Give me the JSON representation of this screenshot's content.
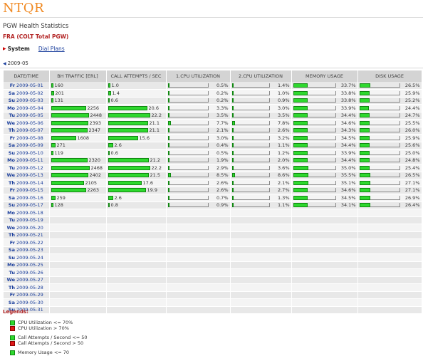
{
  "app": {
    "logo": "NTQR",
    "subtitle": "PGW Health Statistics",
    "node": "FRA (COLT Total PGW)"
  },
  "nav": {
    "system_label": "System",
    "dial_plans_label": "Dial Plans"
  },
  "month": "2009-05",
  "columns": [
    "DATE/TIME",
    "BH TRAFFIC [ERL]",
    "CALL ATTEMPTS / SEC",
    "1.CPU UTILIZATION",
    "2.CPU UTILIZATION",
    "MEMORY USAGE",
    "DISK USAGE"
  ],
  "scale": {
    "traffic_max": 2480,
    "calls_max": 22.5
  },
  "rows": [
    {
      "dow": "Fr",
      "date": "2009-05-01",
      "traffic": "160",
      "calls": "1.0",
      "cpu1": "0.5%",
      "cpu2": "1.4%",
      "mem": "33.7%",
      "disk": "26.5%"
    },
    {
      "dow": "Sa",
      "date": "2009-05-02",
      "traffic": "201",
      "calls": "1.4",
      "cpu1": "0.2%",
      "cpu2": "1.0%",
      "mem": "33.8%",
      "disk": "25.9%"
    },
    {
      "dow": "Su",
      "date": "2009-05-03",
      "traffic": "131",
      "calls": "0.6",
      "cpu1": "0.2%",
      "cpu2": "0.9%",
      "mem": "33.8%",
      "disk": "25.2%"
    },
    {
      "dow": "Mo",
      "date": "2009-05-04",
      "traffic": "2256",
      "calls": "20.6",
      "cpu1": "3.3%",
      "cpu2": "3.0%",
      "mem": "33.9%",
      "disk": "24.4%"
    },
    {
      "dow": "Tu",
      "date": "2009-05-05",
      "traffic": "2448",
      "calls": "22.2",
      "cpu1": "3.5%",
      "cpu2": "3.5%",
      "mem": "34.4%",
      "disk": "24.7%"
    },
    {
      "dow": "We",
      "date": "2009-05-06",
      "traffic": "2393",
      "calls": "21.1",
      "cpu1": "7.7%",
      "cpu2": "7.8%",
      "mem": "34.6%",
      "disk": "25.5%"
    },
    {
      "dow": "Th",
      "date": "2009-05-07",
      "traffic": "2347",
      "calls": "21.1",
      "cpu1": "2.1%",
      "cpu2": "2.6%",
      "mem": "34.3%",
      "disk": "26.0%"
    },
    {
      "dow": "Fr",
      "date": "2009-05-08",
      "traffic": "1608",
      "calls": "15.6",
      "cpu1": "3.0%",
      "cpu2": "3.2%",
      "mem": "34.5%",
      "disk": "25.9%"
    },
    {
      "dow": "Sa",
      "date": "2009-05-09",
      "traffic": "271",
      "calls": "2.6",
      "cpu1": "0.4%",
      "cpu2": "1.1%",
      "mem": "34.4%",
      "disk": "25.6%"
    },
    {
      "dow": "Su",
      "date": "2009-05-10",
      "traffic": "119",
      "calls": "0.6",
      "cpu1": "0.5%",
      "cpu2": "1.2%",
      "mem": "33.9%",
      "disk": "25.0%"
    },
    {
      "dow": "Mo",
      "date": "2009-05-11",
      "traffic": "2320",
      "calls": "21.2",
      "cpu1": "1.9%",
      "cpu2": "2.0%",
      "mem": "34.4%",
      "disk": "24.8%"
    },
    {
      "dow": "Tu",
      "date": "2009-05-12",
      "traffic": "2468",
      "calls": "22.2",
      "cpu1": "2.9%",
      "cpu2": "3.6%",
      "mem": "35.0%",
      "disk": "25.4%"
    },
    {
      "dow": "We",
      "date": "2009-05-13",
      "traffic": "2402",
      "calls": "21.5",
      "cpu1": "8.5%",
      "cpu2": "8.6%",
      "mem": "35.5%",
      "disk": "26.5%"
    },
    {
      "dow": "Th",
      "date": "2009-05-14",
      "traffic": "2105",
      "calls": "17.6",
      "cpu1": "2.6%",
      "cpu2": "2.1%",
      "mem": "35.1%",
      "disk": "27.1%"
    },
    {
      "dow": "Fr",
      "date": "2009-05-15",
      "traffic": "2263",
      "calls": "19.9",
      "cpu1": "2.6%",
      "cpu2": "2.7%",
      "mem": "34.6%",
      "disk": "27.1%"
    },
    {
      "dow": "Sa",
      "date": "2009-05-16",
      "traffic": "259",
      "calls": "2.6",
      "cpu1": "0.7%",
      "cpu2": "1.3%",
      "mem": "34.5%",
      "disk": "26.9%"
    },
    {
      "dow": "Su",
      "date": "2009-05-17",
      "traffic": "128",
      "calls": "0.8",
      "cpu1": "0.9%",
      "cpu2": "1.1%",
      "mem": "34.1%",
      "disk": "26.4%"
    },
    {
      "dow": "Mo",
      "date": "2009-05-18"
    },
    {
      "dow": "Tu",
      "date": "2009-05-19"
    },
    {
      "dow": "We",
      "date": "2009-05-20"
    },
    {
      "dow": "Th",
      "date": "2009-05-21"
    },
    {
      "dow": "Fr",
      "date": "2009-05-22"
    },
    {
      "dow": "Sa",
      "date": "2009-05-23"
    },
    {
      "dow": "Su",
      "date": "2009-05-24"
    },
    {
      "dow": "Mo",
      "date": "2009-05-25"
    },
    {
      "dow": "Tu",
      "date": "2009-05-26"
    },
    {
      "dow": "We",
      "date": "2009-05-27"
    },
    {
      "dow": "Th",
      "date": "2009-05-28"
    },
    {
      "dow": "Fr",
      "date": "2009-05-29"
    },
    {
      "dow": "Sa",
      "date": "2009-05-30"
    },
    {
      "dow": "Su",
      "date": "2009-05-31"
    }
  ],
  "legend": {
    "title": "Legends:",
    "items": [
      {
        "color": "green",
        "label": "CPU Utilization <= 70%"
      },
      {
        "color": "red",
        "label": "CPU Utilization > 70%"
      },
      {
        "color": "green",
        "label": "Call Attempts / Second <= 50"
      },
      {
        "color": "red",
        "label": "Call Attempts / Second > 50"
      },
      {
        "color": "green",
        "label": "Memory Usage <= 70"
      }
    ]
  },
  "colors": {
    "logo": "#f08a24",
    "node": "#b22222",
    "link": "#1a3e9c",
    "bar_ok": "#2ed82e",
    "bar_bad": "#e01818",
    "header_bg": "#d4d4d4"
  }
}
